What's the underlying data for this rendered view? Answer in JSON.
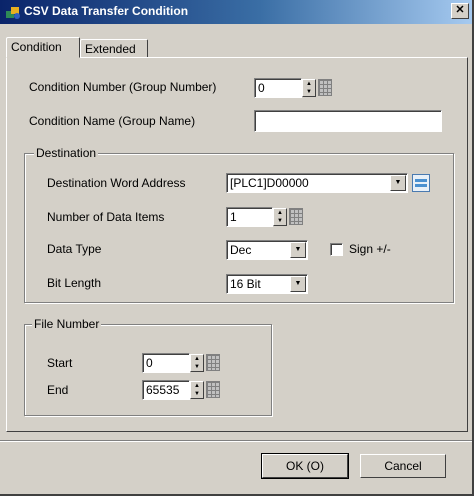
{
  "window": {
    "title": "CSV Data Transfer Condition",
    "close_glyph": "✕"
  },
  "tabs": [
    {
      "label": "Condition",
      "active": true
    },
    {
      "label": "Extended",
      "active": false
    }
  ],
  "condition": {
    "number_label": "Condition Number (Group Number)",
    "number_value": "0",
    "name_label": "Condition Name (Group Name)",
    "name_value": ""
  },
  "destination": {
    "group_title": "Destination",
    "address_label": "Destination Word Address",
    "address_value": "[PLC1]D00000",
    "items_label": "Number of Data Items",
    "items_value": "1",
    "type_label": "Data Type",
    "type_value": "Dec",
    "sign_label": "Sign +/-",
    "sign_checked": false,
    "bitlen_label": "Bit Length",
    "bitlen_value": "16 Bit"
  },
  "file_number": {
    "group_title": "File Number",
    "start_label": "Start",
    "start_value": "0",
    "end_label": "End",
    "end_value": "65535"
  },
  "footer": {
    "ok_label": "OK (O)",
    "cancel_label": "Cancel"
  },
  "icons": [
    "app-icon",
    "spin-arrow-icon",
    "grid-input-icon",
    "dropdown-arrow-icon",
    "keypad-icon"
  ],
  "colors": {
    "titlebar_start": "#0a246a",
    "titlebar_end": "#a6caf0",
    "face": "#d4d0c8"
  }
}
